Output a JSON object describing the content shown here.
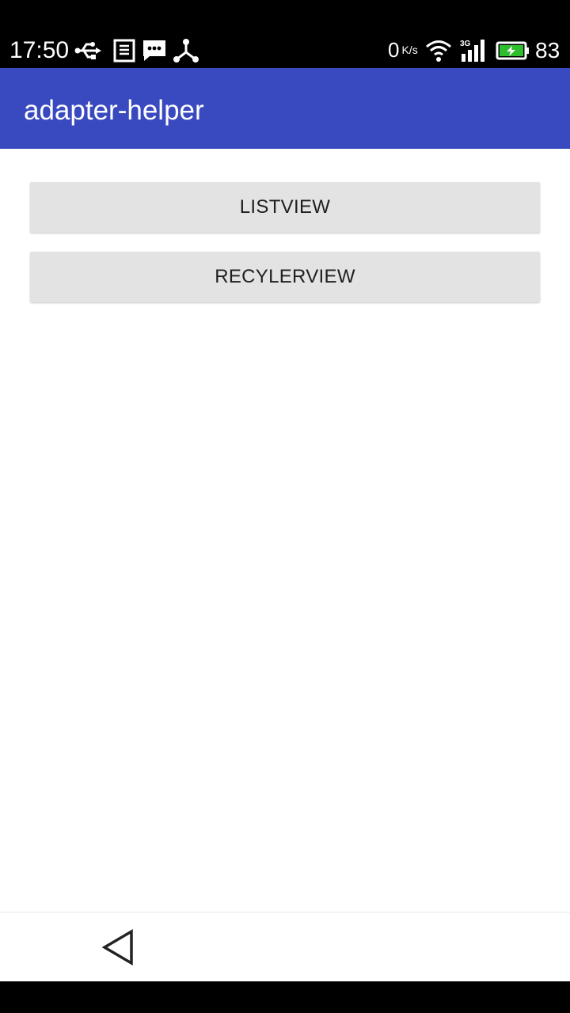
{
  "status_bar": {
    "time": "17:50",
    "network_speed_value": "0",
    "network_speed_unit": "K/s",
    "battery_level": "83",
    "icons": [
      "usb-icon",
      "notification-app-icon",
      "message-icon",
      "share-icon",
      "wifi-icon",
      "signal-3g-icon",
      "battery-icon"
    ],
    "battery_color": "#2dbd2d"
  },
  "app_bar": {
    "title": "adapter-helper",
    "color": "#3949BF"
  },
  "main": {
    "buttons": [
      {
        "label": "LISTVIEW"
      },
      {
        "label": "RECYLERVIEW"
      }
    ]
  },
  "nav_bar": {
    "back_icon": "back-triangle-icon"
  }
}
